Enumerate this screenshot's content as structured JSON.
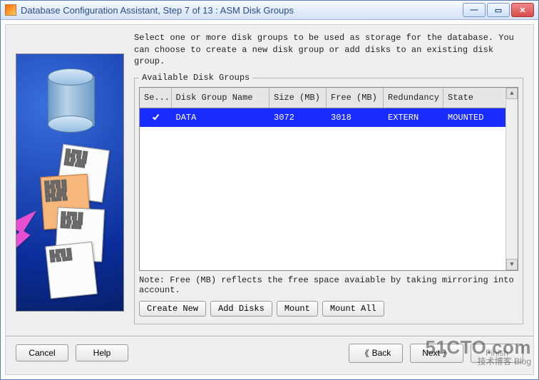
{
  "window": {
    "title": "Database Configuration Assistant, Step 7 of 13 : ASM Disk Groups"
  },
  "instructions": "Select one or more disk groups to be used as storage for the database. You can choose to create a new disk group or add disks to an existing disk group.",
  "groupbox_legend": "Available Disk Groups",
  "table": {
    "headers": {
      "select": "Se...",
      "name": "Disk Group Name",
      "size": "Size (MB)",
      "free": "Free (MB)",
      "redundancy": "Redundancy",
      "state": "State"
    },
    "rows": [
      {
        "selected": true,
        "name": "DATA",
        "size": "3072",
        "free": "3018",
        "redundancy": "EXTERN",
        "state": "MOUNTED"
      }
    ]
  },
  "note": "Note: Free (MB) reflects the free space avaiable by taking mirroring into account.",
  "buttons": {
    "create_new": "Create New",
    "add_disks": "Add Disks",
    "mount": "Mount",
    "mount_all": "Mount All"
  },
  "footer": {
    "cancel": "Cancel",
    "help": "Help",
    "back_glyph": "《",
    "back": "Back",
    "next": "Next",
    "next_glyph": "》",
    "finish": "Finish"
  },
  "watermark": {
    "line1": "51CTO.com",
    "line2": "技术博客    Blog"
  },
  "colors": {
    "selection": "#1a2cff"
  }
}
